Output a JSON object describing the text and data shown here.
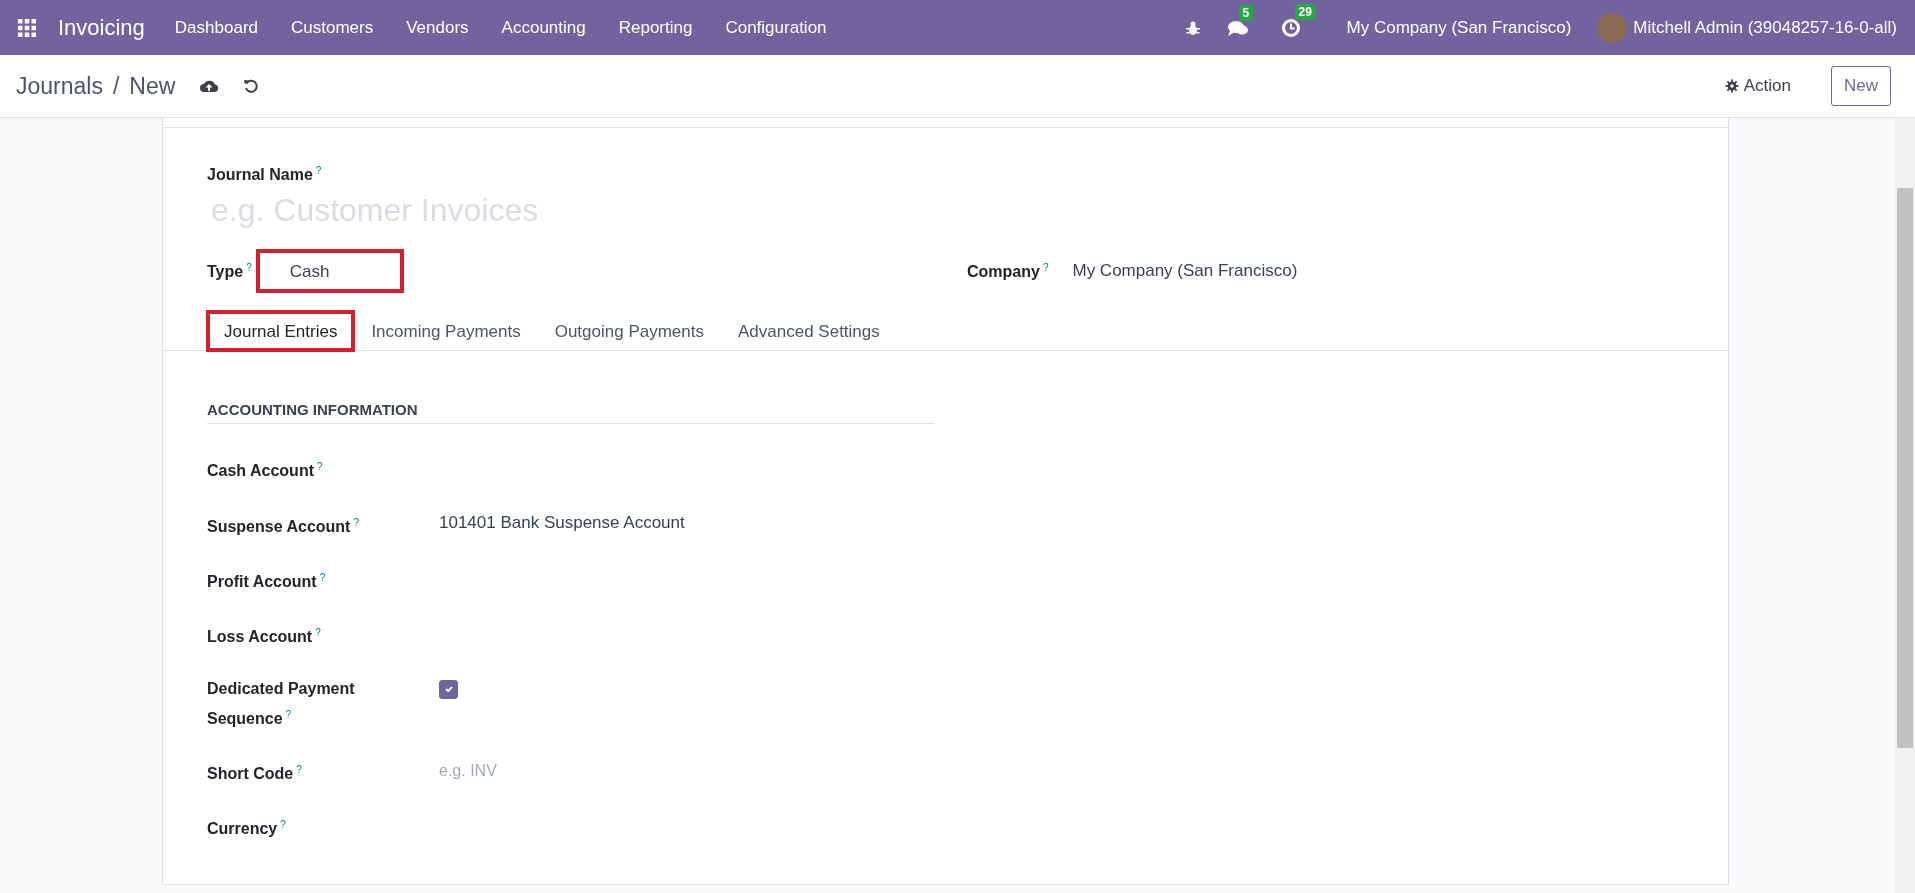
{
  "navbar": {
    "app_name": "Invoicing",
    "menu": [
      "Dashboard",
      "Customers",
      "Vendors",
      "Accounting",
      "Reporting",
      "Configuration"
    ],
    "messages_count": "5",
    "activities_count": "29",
    "company": "My Company (San Francisco)",
    "user": "Mitchell Admin (39048257-16-0-all)"
  },
  "control_panel": {
    "breadcrumb": "Journals",
    "separator": "/",
    "current": "New",
    "action": "Action",
    "new_button": "New"
  },
  "form": {
    "journal_name": {
      "label": "Journal Name",
      "help": "?",
      "placeholder": "e.g. Customer Invoices"
    },
    "type": {
      "label": "Type",
      "help": "?",
      "value": "Cash",
      "highlighted": true
    },
    "company": {
      "label": "Company",
      "help": "?",
      "value": "My Company (San Francisco)"
    },
    "tabs": [
      {
        "label": "Journal Entries",
        "selected": true,
        "highlighted": true
      },
      {
        "label": "Incoming Payments",
        "selected": false,
        "highlighted": false
      },
      {
        "label": "Outgoing Payments",
        "selected": false,
        "highlighted": false
      },
      {
        "label": "Advanced Settings",
        "selected": false,
        "highlighted": false
      }
    ],
    "section_title": "ACCOUNTING INFORMATION",
    "fields": [
      {
        "kind": "empty",
        "label": "Cash Account",
        "help": "?"
      },
      {
        "kind": "text",
        "label": "Suspense Account",
        "help": "?",
        "value": "101401 Bank Suspense Account"
      },
      {
        "kind": "empty",
        "label": "Profit Account",
        "help": "?"
      },
      {
        "kind": "empty",
        "label": "Loss Account",
        "help": "?"
      },
      {
        "kind": "checkbox",
        "label": "Dedicated Payment Sequence",
        "help": "?",
        "checked": true
      },
      {
        "kind": "placeholder",
        "label": "Short Code",
        "help": "?",
        "placeholder": "e.g. INV"
      },
      {
        "kind": "empty",
        "label": "Currency",
        "help": "?"
      }
    ]
  }
}
